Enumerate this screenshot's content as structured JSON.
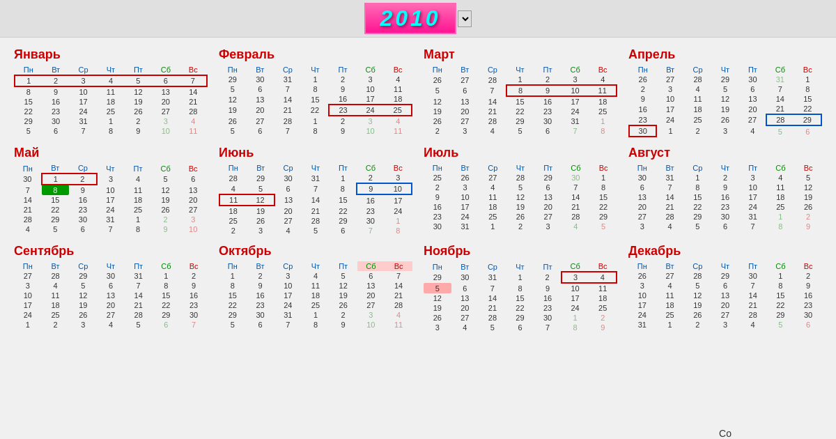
{
  "year": "2010",
  "months": [
    {
      "name": "Январь",
      "weeks": [
        [
          "1",
          "2",
          "3",
          "4",
          "5",
          "6",
          "7"
        ],
        [
          "8",
          "9",
          "10",
          "11",
          "12",
          "13",
          "14"
        ],
        [
          "15",
          "16",
          "17",
          "18",
          "19",
          "20",
          "21"
        ],
        [
          "22",
          "23",
          "24",
          "25",
          "26",
          "27",
          "28"
        ],
        [
          "29",
          "30",
          "31",
          "1o",
          "2o",
          "3o",
          "4o"
        ],
        [
          "5o",
          "6o",
          "7o",
          "8o",
          "9o",
          "10o",
          "11o"
        ]
      ],
      "highlights": {
        "red_box_row": 0,
        "blue_box": []
      }
    },
    {
      "name": "Февраль",
      "weeks": [
        [
          "29o",
          "30o",
          "31o",
          "1",
          "2",
          "3",
          "4"
        ],
        [
          "5",
          "6",
          "7",
          "8",
          "9",
          "10",
          "11"
        ],
        [
          "12",
          "13",
          "14",
          "15",
          "16",
          "17",
          "18"
        ],
        [
          "19",
          "20",
          "21",
          "22",
          "23",
          "24",
          "25"
        ],
        [
          "26",
          "27",
          "28",
          "1o",
          "2o",
          "3o",
          "4o"
        ],
        [
          "5o",
          "6o",
          "7o",
          "8o",
          "9o",
          "10o",
          "11o"
        ]
      ]
    },
    {
      "name": "Март",
      "weeks": [
        [
          "26o",
          "27o",
          "28o",
          "1",
          "2",
          "3",
          "4"
        ],
        [
          "5",
          "6",
          "7",
          "8",
          "9",
          "10",
          "11"
        ],
        [
          "12",
          "13",
          "14",
          "15",
          "16",
          "17",
          "18"
        ],
        [
          "19",
          "20",
          "21",
          "22",
          "23",
          "24",
          "25"
        ],
        [
          "26",
          "27",
          "28",
          "29",
          "30",
          "31",
          "1o"
        ],
        [
          "2o",
          "3o",
          "4o",
          "5o",
          "6o",
          "7o",
          "8o"
        ]
      ]
    },
    {
      "name": "Апрель",
      "weeks": [
        [
          "26o",
          "27o",
          "28o",
          "29o",
          "30o",
          "31o",
          "1"
        ],
        [
          "2",
          "3",
          "4",
          "5",
          "6",
          "7",
          "8"
        ],
        [
          "9",
          "10",
          "11",
          "12",
          "13",
          "14",
          "15"
        ],
        [
          "16",
          "17",
          "18",
          "19",
          "20",
          "21",
          "22"
        ],
        [
          "23",
          "24",
          "25",
          "26",
          "27",
          "28",
          "29"
        ],
        [
          "30",
          "1o",
          "2o",
          "3o",
          "4o",
          "5o",
          "6o"
        ]
      ]
    },
    {
      "name": "Май",
      "weeks": [
        [
          "30o",
          "1",
          "2",
          "3",
          "4",
          "5",
          "6"
        ],
        [
          "7",
          "8",
          "9",
          "10",
          "11",
          "12",
          "13"
        ],
        [
          "14",
          "15",
          "16",
          "17",
          "18",
          "19",
          "20"
        ],
        [
          "21",
          "22",
          "23",
          "24",
          "25",
          "26",
          "27"
        ],
        [
          "28",
          "29",
          "30",
          "31",
          "1o",
          "2o",
          "3o"
        ],
        [
          "4o",
          "5o",
          "6o",
          "7o",
          "8o",
          "9o",
          "10o"
        ]
      ]
    },
    {
      "name": "Июнь",
      "weeks": [
        [
          "28o",
          "29o",
          "30o",
          "31o",
          "1",
          "2",
          "3"
        ],
        [
          "4",
          "5",
          "6",
          "7",
          "8",
          "9",
          "10"
        ],
        [
          "11",
          "12",
          "13",
          "14",
          "15",
          "16",
          "17"
        ],
        [
          "18",
          "19",
          "20",
          "21",
          "22",
          "23",
          "24"
        ],
        [
          "25",
          "26",
          "27",
          "28",
          "29",
          "30",
          "1o"
        ],
        [
          "2o",
          "3o",
          "4o",
          "5o",
          "6o",
          "7o",
          "8o"
        ]
      ]
    },
    {
      "name": "Июль",
      "weeks": [
        [
          "25o",
          "26o",
          "27o",
          "28o",
          "29o",
          "30o",
          "1"
        ],
        [
          "2",
          "3",
          "4",
          "5",
          "6",
          "7",
          "8"
        ],
        [
          "9",
          "10",
          "11",
          "12",
          "13",
          "14",
          "15"
        ],
        [
          "16",
          "17",
          "18",
          "19",
          "20",
          "21",
          "22"
        ],
        [
          "23",
          "24",
          "25",
          "26",
          "27",
          "28",
          "29"
        ],
        [
          "30",
          "31",
          "1o",
          "2o",
          "3o",
          "4o",
          "5o"
        ]
      ]
    },
    {
      "name": "Август",
      "weeks": [
        [
          "30o",
          "31o",
          "1",
          "2",
          "3",
          "4",
          "5"
        ],
        [
          "6",
          "7",
          "8",
          "9",
          "10",
          "11",
          "12"
        ],
        [
          "13",
          "14",
          "15",
          "16",
          "17",
          "18",
          "19"
        ],
        [
          "20",
          "21",
          "22",
          "23",
          "24",
          "25",
          "26"
        ],
        [
          "27",
          "28",
          "29",
          "30",
          "31",
          "1o",
          "2o"
        ],
        [
          "3o",
          "4o",
          "5o",
          "6o",
          "7o",
          "8o",
          "9o"
        ]
      ]
    },
    {
      "name": "Сентябрь",
      "weeks": [
        [
          "27o",
          "28o",
          "29o",
          "30o",
          "31o",
          "1",
          "2"
        ],
        [
          "3",
          "4",
          "5",
          "6",
          "7",
          "8",
          "9"
        ],
        [
          "10",
          "11",
          "12",
          "13",
          "14",
          "15",
          "16"
        ],
        [
          "17",
          "18",
          "19",
          "20",
          "21",
          "22",
          "23"
        ],
        [
          "24",
          "25",
          "26",
          "27",
          "28",
          "29",
          "30"
        ],
        [
          "1o",
          "2o",
          "3o",
          "4o",
          "5o",
          "6o",
          "7o"
        ]
      ]
    },
    {
      "name": "Октябрь",
      "weeks": [
        [
          "1",
          "2",
          "3",
          "4",
          "5",
          "6",
          "7"
        ],
        [
          "8",
          "9",
          "10",
          "11",
          "12",
          "13",
          "14"
        ],
        [
          "15",
          "16",
          "17",
          "18",
          "19",
          "20",
          "21"
        ],
        [
          "22",
          "23",
          "24",
          "25",
          "26",
          "27",
          "28"
        ],
        [
          "29",
          "30",
          "31",
          "1o",
          "2o",
          "3o",
          "4o"
        ],
        [
          "5o",
          "6o",
          "7o",
          "8o",
          "9o",
          "10o",
          "11o"
        ]
      ]
    },
    {
      "name": "Ноябрь",
      "weeks": [
        [
          "29o",
          "30o",
          "31o",
          "1",
          "2",
          "3",
          "4"
        ],
        [
          "5",
          "6",
          "7",
          "8",
          "9",
          "10",
          "11"
        ],
        [
          "12",
          "13",
          "14",
          "15",
          "16",
          "17",
          "18"
        ],
        [
          "19",
          "20",
          "21",
          "22",
          "23",
          "24",
          "25"
        ],
        [
          "26",
          "27",
          "28",
          "29",
          "30",
          "1o",
          "2o"
        ],
        [
          "3o",
          "4o",
          "5o",
          "6o",
          "7o",
          "8o",
          "9o"
        ]
      ]
    },
    {
      "name": "Декабрь",
      "weeks": [
        [
          "26o",
          "27o",
          "28o",
          "29o",
          "30o",
          "1",
          "2"
        ],
        [
          "3",
          "4",
          "5",
          "6",
          "7",
          "8",
          "9"
        ],
        [
          "10",
          "11",
          "12",
          "13",
          "14",
          "15",
          "16"
        ],
        [
          "17",
          "18",
          "19",
          "20",
          "21",
          "22",
          "23"
        ],
        [
          "24",
          "25",
          "26",
          "27",
          "28",
          "29",
          "30"
        ],
        [
          "31",
          "1o",
          "2o",
          "3o",
          "4o",
          "5o",
          "6o"
        ]
      ]
    }
  ],
  "weekdays": [
    "Пн",
    "Вт",
    "Ср",
    "Чт",
    "Пт",
    "Сб",
    "Вс"
  ]
}
